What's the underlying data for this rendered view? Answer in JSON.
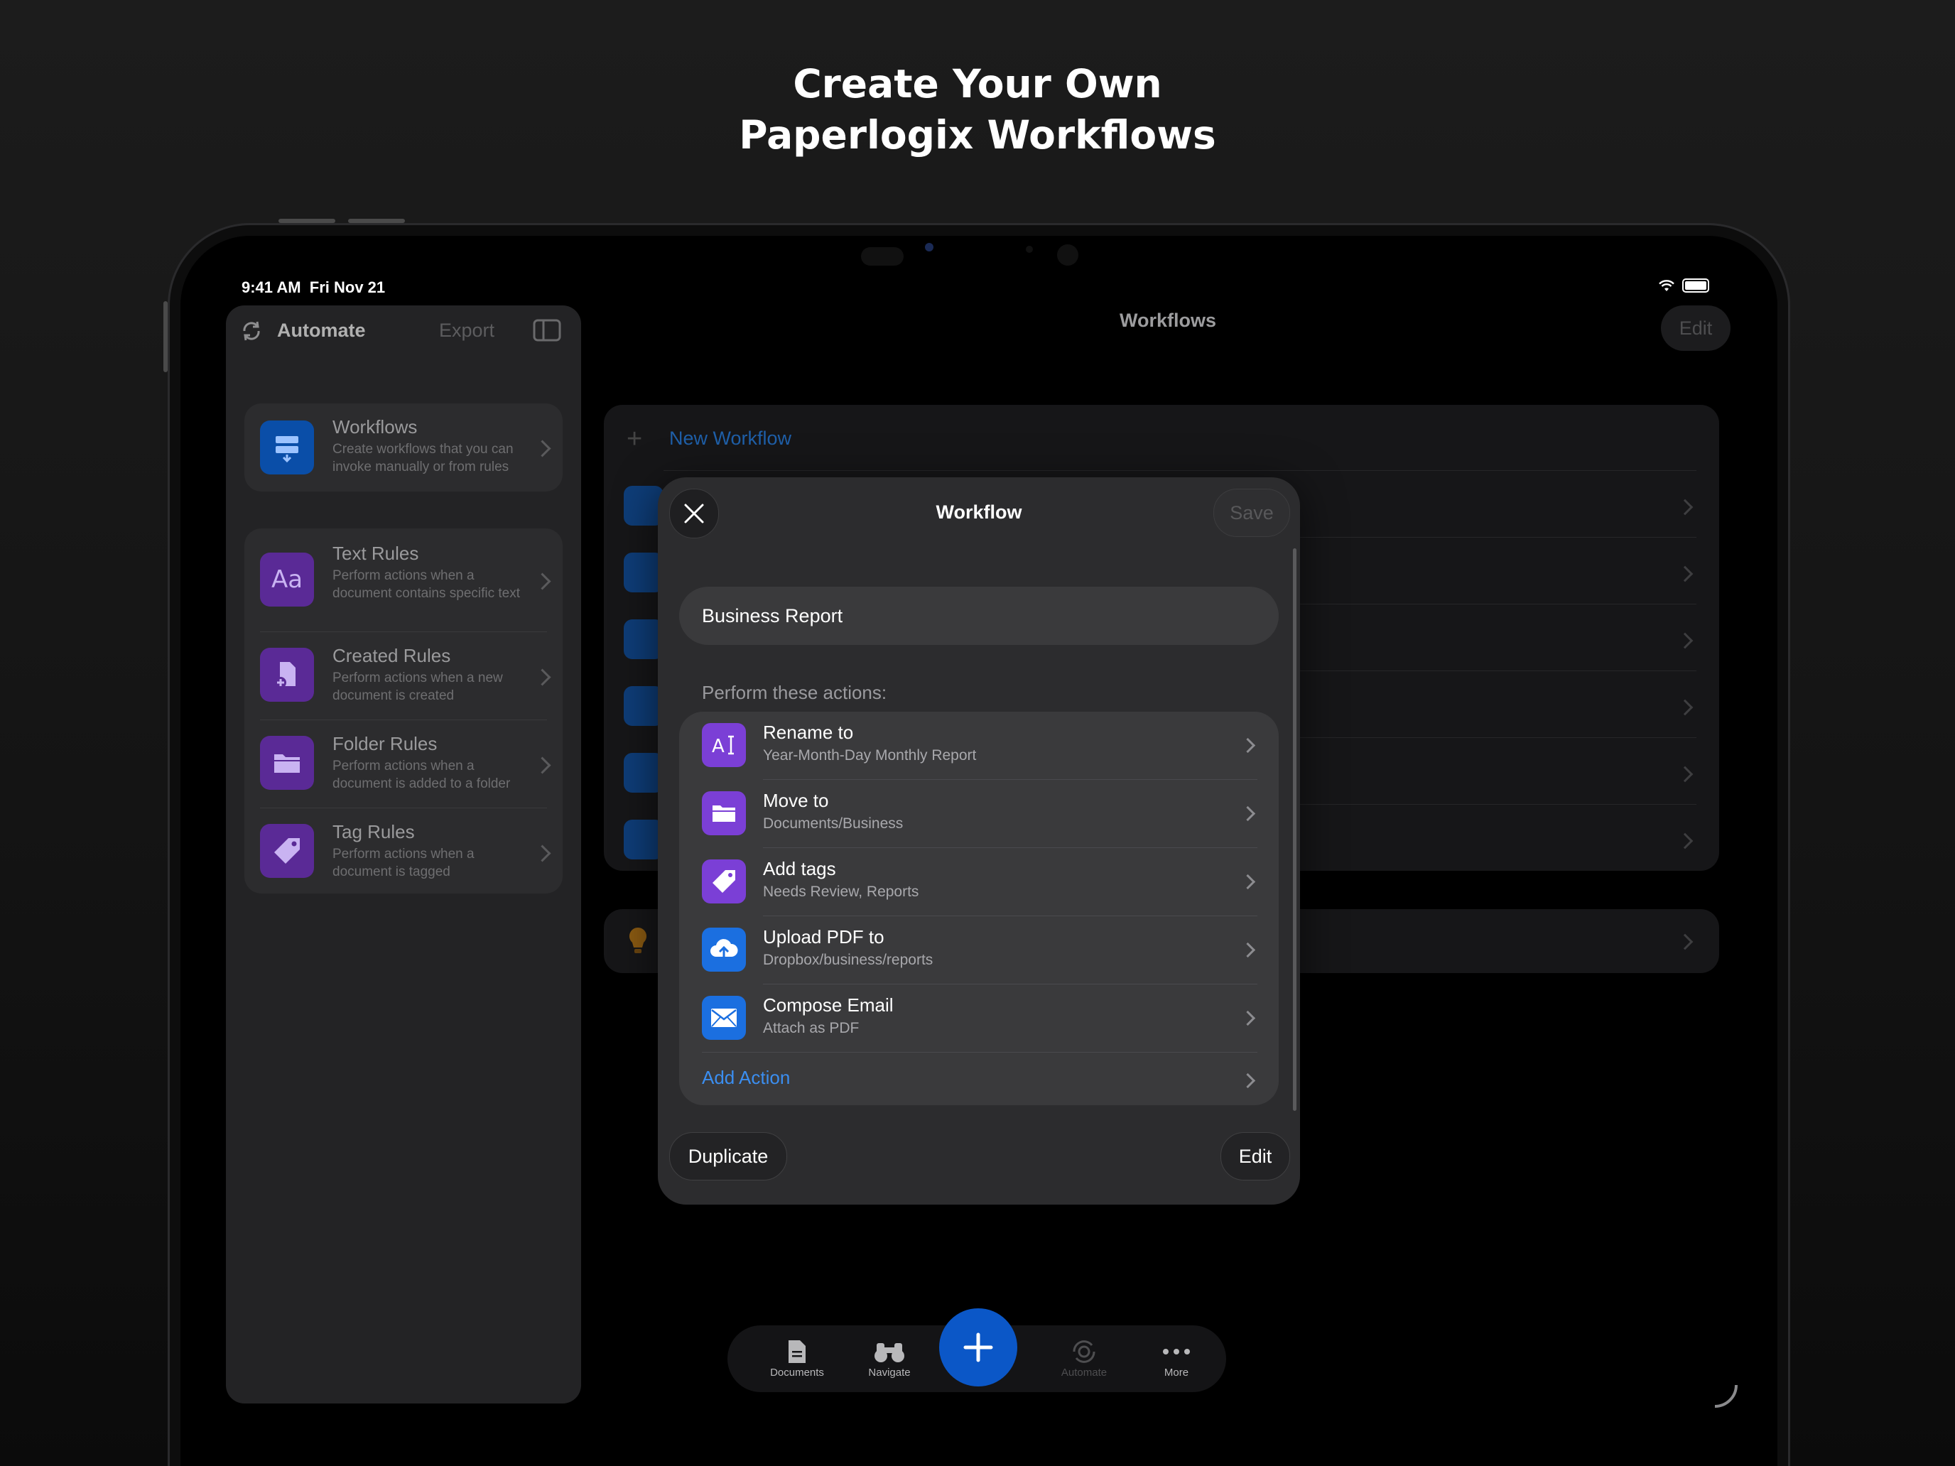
{
  "headline": {
    "line1": "Create Your Own",
    "line2": "Paperlogix Workflows"
  },
  "status_bar": {
    "time": "9:41 AM",
    "date": "Fri Nov 21"
  },
  "sidebar": {
    "title": "Automate",
    "export_label": "Export",
    "items": [
      {
        "title": "Workflows",
        "subtitle": "Create workflows that you can invoke manually or from rules",
        "icon": "workflow-icon",
        "color": "#0a4ea8"
      },
      {
        "title": "Text Rules",
        "subtitle": "Perform actions when a document contains specific text",
        "icon": "text-aa-icon",
        "color": "#5a2a96"
      },
      {
        "title": "Created Rules",
        "subtitle": "Perform actions when a new document is created",
        "icon": "document-plus-icon",
        "color": "#5a2a96"
      },
      {
        "title": "Folder Rules",
        "subtitle": "Perform actions when a document is added to a folder",
        "icon": "folder-icon",
        "color": "#5a2a96"
      },
      {
        "title": "Tag Rules",
        "subtitle": "Perform actions when a document is tagged",
        "icon": "tag-icon",
        "color": "#5a2a96"
      }
    ]
  },
  "main": {
    "title": "Workflows",
    "edit_label": "Edit",
    "new_workflow_label": "New Workflow"
  },
  "modal": {
    "title": "Workflow",
    "save_label": "Save",
    "name_value": "Business Report",
    "section_label": "Perform these actions:",
    "actions": [
      {
        "title": "Rename to",
        "subtitle": "Year-Month-Day Monthly Report",
        "icon": "rename-icon",
        "color": "#7b3fd6"
      },
      {
        "title": "Move to",
        "subtitle": "Documents/Business",
        "icon": "folder-icon",
        "color": "#7b3fd6"
      },
      {
        "title": "Add tags",
        "subtitle": "Needs Review, Reports",
        "icon": "tag-icon",
        "color": "#7b3fd6"
      },
      {
        "title": "Upload PDF to",
        "subtitle": "Dropbox/business/reports",
        "icon": "cloud-upload-icon",
        "color": "#1b6fe0"
      },
      {
        "title": "Compose Email",
        "subtitle": "Attach as PDF",
        "icon": "envelope-icon",
        "color": "#1b6fe0"
      }
    ],
    "add_action_label": "Add Action",
    "duplicate_label": "Duplicate",
    "edit_label": "Edit"
  },
  "tabbar": {
    "tabs": [
      {
        "label": "Documents",
        "icon": "document-icon",
        "state": "normal"
      },
      {
        "label": "Navigate",
        "icon": "binoculars-icon",
        "state": "normal"
      },
      {
        "label": "Automate",
        "icon": "gear-sync-icon",
        "state": "dimmed"
      },
      {
        "label": "More",
        "icon": "ellipsis-icon",
        "state": "normal"
      }
    ],
    "fab_icon": "plus-icon"
  },
  "colors": {
    "accent": "#0b57c7",
    "link": "#3b8ef0",
    "purple": "#7b3fd6"
  }
}
